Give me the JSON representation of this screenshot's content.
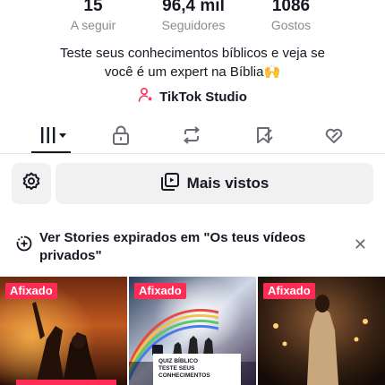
{
  "profile": {
    "stats": [
      {
        "value": "15",
        "label": "A seguir"
      },
      {
        "value": "96,4 mil",
        "label": "Seguidores"
      },
      {
        "value": "1086",
        "label": "Gostos"
      }
    ],
    "bio_line1": "Teste seus conhecimentos bíblicos e veja se",
    "bio_line2": "você é um expert na Bíblia🙌",
    "studio_label": "TikTok Studio"
  },
  "tabs": [
    {
      "name": "videos",
      "icon": "grid-bars-icon",
      "active": true
    },
    {
      "name": "private",
      "icon": "lock-icon"
    },
    {
      "name": "reposts",
      "icon": "repost-icon"
    },
    {
      "name": "favorites",
      "icon": "bookmark-icon"
    },
    {
      "name": "liked",
      "icon": "heart-icon"
    }
  ],
  "sort": {
    "label": "Mais vistos"
  },
  "banner": {
    "text": "Ver Stories expirados em \"Os teus vídeos privados\"",
    "close": "✕"
  },
  "videos": [
    {
      "badge": "Afixado"
    },
    {
      "badge": "Afixado",
      "card_line1": "QUIZ BÍBLICO",
      "card_line2": "TESTE SEUS",
      "card_line3": "CONHECIMENTOS"
    },
    {
      "badge": "Afixado"
    }
  ],
  "colors": {
    "accent": "#fe2c55",
    "text": "#161823",
    "muted": "#8a8b91",
    "surface": "#f1f1f2"
  }
}
